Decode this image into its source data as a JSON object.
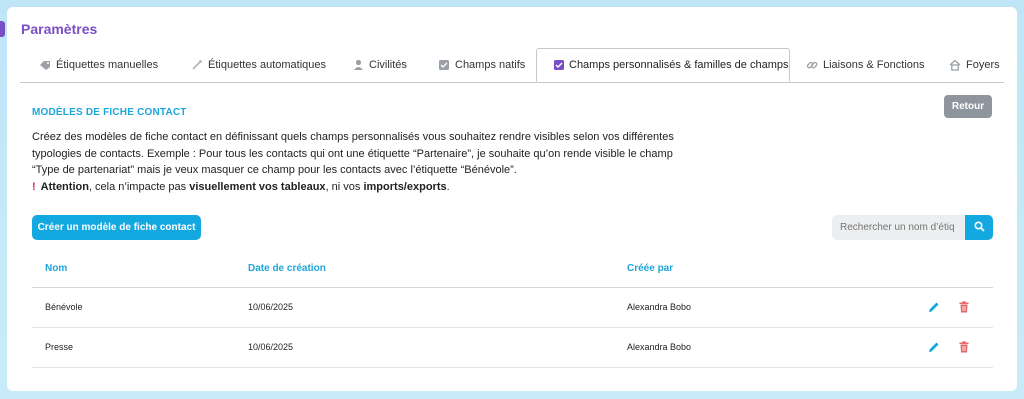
{
  "page": {
    "title": "Paramètres"
  },
  "tabs": [
    {
      "label": "Étiquettes manuelles",
      "icon": "tag-icon"
    },
    {
      "label": "Étiquettes automatiques",
      "icon": "wand-icon"
    },
    {
      "label": "Civilités",
      "icon": "person-icon"
    },
    {
      "label": "Champs natifs",
      "icon": "checkbox-icon"
    },
    {
      "label": "Champs personnalisés & familles de champs",
      "icon": "checkbox-checked-icon",
      "active": true
    },
    {
      "label": "Liaisons & Fonctions",
      "icon": "link-icon"
    },
    {
      "label": "Foyers",
      "icon": "home-icon"
    }
  ],
  "section": {
    "title": "MODÈLES DE FICHE CONTACT",
    "back_label": "Retour",
    "description": "Créez des modèles de fiche contact en définissant quels champs personnalisés vous souhaitez rendre visibles selon vos différentes typologies de contacts. Exemple : Pour tous les contacts qui ont une étiquette “Partenaire”, je souhaite qu’on rende visible le champ “Type de partenariat” mais je veux masquer ce champ pour les contacts avec l’étiquette “Bénévole”.",
    "warning": {
      "mark": "!",
      "lead": "Attention",
      "t1": ", cela n’impacte pas ",
      "b1": "visuellement vos tableaux",
      "t2": ", ni vos ",
      "b2": "imports/exports",
      "t3": "."
    },
    "create_label": "Créer un modèle de fiche contact",
    "search_placeholder": "Rechercher un nom d’étiq"
  },
  "table": {
    "headers": {
      "name": "Nom",
      "date": "Date de création",
      "creator": "Créée par"
    },
    "rows": [
      {
        "name": "Bénévole",
        "date": "10/06/2025",
        "creator": "Alexandra Bobo"
      },
      {
        "name": "Presse",
        "date": "10/06/2025",
        "creator": "Alexandra Bobo"
      }
    ]
  },
  "colors": {
    "accent_purple": "#7b4fc4",
    "primary_blue": "#14a8e0",
    "delete_red": "#e46a6a",
    "warning_red": "#e0245e"
  }
}
